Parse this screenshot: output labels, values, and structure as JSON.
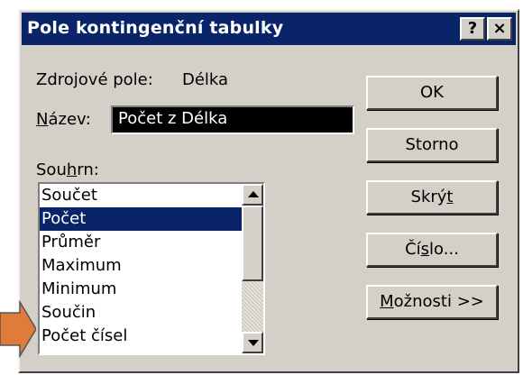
{
  "window": {
    "title": "Pole kontingenční tabulky",
    "help_glyph": "?",
    "close_glyph": "×"
  },
  "source": {
    "label": "Zdrojové pole:",
    "value": "Délka"
  },
  "name": {
    "label_underlined": "N",
    "label_rest": "ázev:",
    "value": "Počet z Délka"
  },
  "summary": {
    "label_start": "Sou",
    "label_underlined": "h",
    "label_end": "rn:",
    "items": [
      "Součet",
      "Počet",
      "Průměr",
      "Maximum",
      "Minimum",
      "Součin",
      "Počet čísel"
    ],
    "selected": "Počet"
  },
  "buttons": {
    "ok": "OK",
    "cancel": "Storno",
    "hide_start": "Skrý",
    "hide_underlined": "t",
    "number_start": "Čí",
    "number_underlined": "s",
    "number_end": "lo...",
    "options_underlined": "M",
    "options_rest": "ožnosti >>"
  },
  "colors": {
    "titlebar": "#0a246a",
    "dialog_face": "#d4d0c8",
    "selection": "#0a246a",
    "pointer_arrow": "#e07b39"
  }
}
